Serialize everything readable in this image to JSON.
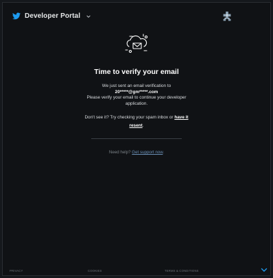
{
  "header": {
    "brand_label": "Developer Portal"
  },
  "verify": {
    "title": "Time to verify your email",
    "sent_line": "We just sent an email verification to",
    "email": "20*****@gm*****.com",
    "instruction": "Please verify your email to continue your developer application.",
    "not_seen_text": "Don't see it? Try checking your spam inbox or",
    "resend_link": "have it resent",
    "resend_suffix": "."
  },
  "help": {
    "prefix": "Need help?",
    "support_link": "Get support now",
    "suffix": "."
  },
  "footer": {
    "privacy": "PRIVACY",
    "cookies": "COOKIES",
    "terms": "TERMS & CONDITIONS"
  },
  "colors": {
    "background": "#101215",
    "accent": "#1d9bf0",
    "text": "#ffffff"
  }
}
